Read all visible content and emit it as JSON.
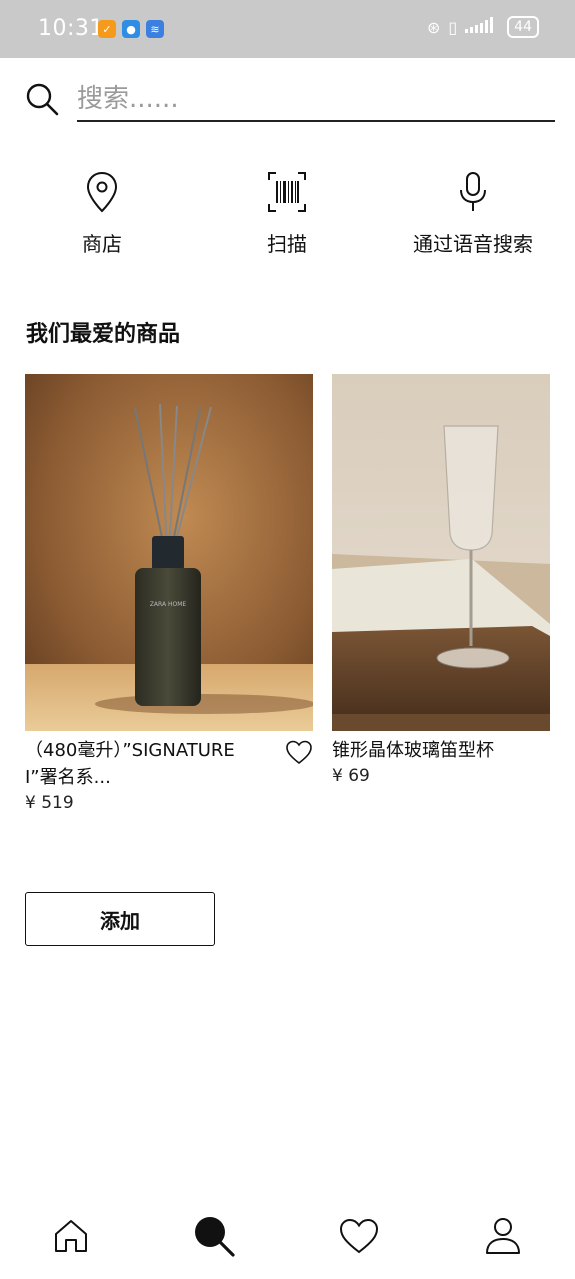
{
  "status_bar": {
    "time": "10:31",
    "battery": "44"
  },
  "search": {
    "placeholder": "搜索......",
    "value": ""
  },
  "shortcuts": [
    {
      "label": "商店",
      "icon": "location-pin-icon"
    },
    {
      "label": "扫描",
      "icon": "barcode-scan-icon"
    },
    {
      "label": "通过语音搜索",
      "icon": "microphone-icon"
    }
  ],
  "favorites": {
    "title": "我们最爱的商品",
    "items": [
      {
        "name": "（480毫升）”SIGNATURE I”署名系...",
        "price": "¥ 519",
        "image": "reed-diffuser-photo"
      },
      {
        "name": "锥形晶体玻璃笛型杯",
        "price": "¥ 69",
        "image": "champagne-flute-photo"
      }
    ]
  },
  "add_button": {
    "label": "添加"
  },
  "bottom_nav": [
    {
      "icon": "home-icon"
    },
    {
      "icon": "search-icon"
    },
    {
      "icon": "heart-icon"
    },
    {
      "icon": "user-icon"
    }
  ],
  "colors": {
    "status_bar": "#c9c9c9",
    "text": "#111111",
    "placeholder": "#9a9a9a"
  }
}
